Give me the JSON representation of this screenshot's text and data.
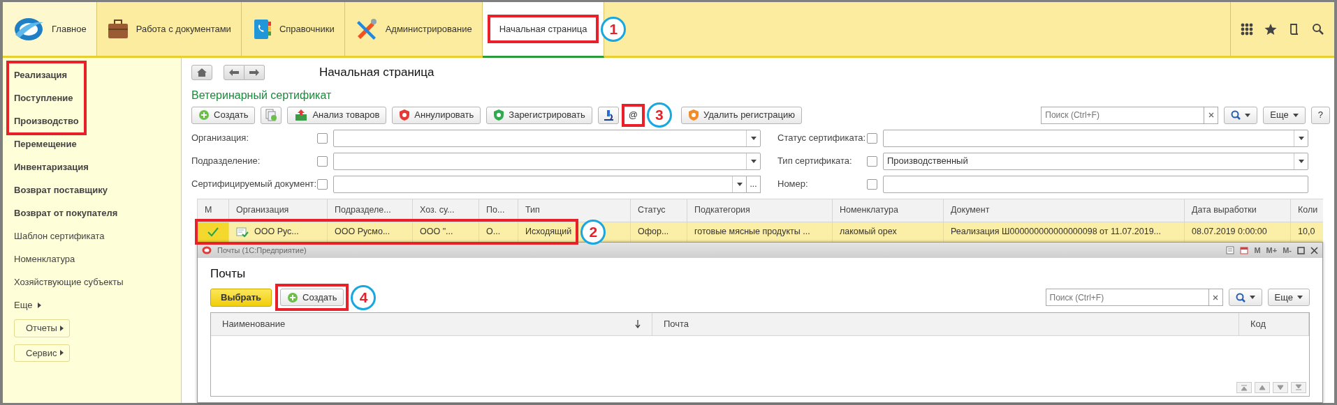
{
  "top_bar": {
    "sections": [
      {
        "label": "Главное",
        "selected": false,
        "highlighted": false
      },
      {
        "label": "Работа с документами",
        "selected": false,
        "highlighted": false
      },
      {
        "label": "Справочники",
        "selected": false,
        "highlighted": false
      },
      {
        "label": "Администрирование",
        "selected": false,
        "highlighted": false
      },
      {
        "label": "Начальная страница",
        "selected": true,
        "highlighted": true,
        "callout": "1"
      }
    ]
  },
  "sidebar": {
    "items": [
      {
        "label": "Реализация",
        "emphasized": true,
        "highlighted": true
      },
      {
        "label": "Поступление",
        "emphasized": true,
        "highlighted": true
      },
      {
        "label": "Производство",
        "emphasized": true,
        "highlighted": true
      },
      {
        "label": "Перемещение",
        "emphasized": true,
        "highlighted": false
      },
      {
        "label": "Инвентаризация",
        "emphasized": true,
        "highlighted": false
      },
      {
        "label": "Возврат поставщику",
        "emphasized": true,
        "highlighted": false
      },
      {
        "label": "Возврат от покупателя",
        "emphasized": true,
        "highlighted": false
      },
      {
        "label": "Шаблон сертификата",
        "emphasized": false,
        "highlighted": false
      },
      {
        "label": "Номенклатура",
        "emphasized": false,
        "highlighted": false
      },
      {
        "label": "Хозяйствующие субъекты",
        "emphasized": false,
        "highlighted": false
      },
      {
        "label": "Еще",
        "emphasized": false,
        "highlighted": false,
        "kind": "more"
      }
    ],
    "buttons": [
      "Отчеты",
      "Сервис"
    ]
  },
  "page": {
    "title": "Начальная страница",
    "form_title": "Ветеринарный сертификат",
    "toolbar": [
      {
        "kind": "button",
        "label": "Создать",
        "highlighted": false
      },
      {
        "kind": "icon",
        "highlighted": false
      },
      {
        "kind": "button",
        "label": "Анализ товаров",
        "highlighted": false
      },
      {
        "kind": "button",
        "label": "Аннулировать",
        "highlighted": false
      },
      {
        "kind": "button",
        "label": "Зарегистрировать",
        "highlighted": false
      },
      {
        "kind": "icon",
        "highlighted": false
      },
      {
        "kind": "text",
        "label": "@",
        "highlighted": true,
        "callout": "3"
      },
      {
        "kind": "button",
        "label": "Удалить регистрацию",
        "highlighted": false
      }
    ],
    "search": {
      "placeholder": "Поиск (Ctrl+F)"
    },
    "more": "Еще",
    "help": "?",
    "filters_left": [
      {
        "label": "Организация:",
        "checked": false,
        "kind": "select"
      },
      {
        "label": "Подразделение:",
        "checked": false,
        "kind": "select"
      },
      {
        "label": "Сертифицируемый документ:",
        "checked": false,
        "kind": "choice",
        "choice_button": "..."
      }
    ],
    "filters_right": [
      {
        "label": "Статус сертификата:",
        "checked": false,
        "kind": "select"
      },
      {
        "label": "Тип сертификата:",
        "checked": false,
        "kind": "select",
        "value": "Производственный"
      },
      {
        "label": "Номер:",
        "checked": false,
        "kind": "text"
      }
    ],
    "table": {
      "columns": [
        "М",
        "Организация",
        "Подразделе...",
        "Хоз. су...",
        "По...",
        "Тип",
        "Статус",
        "Подкатегория",
        "Номенклатура",
        "Документ",
        "Дата выработки",
        "Коли"
      ],
      "rows": [
        {
          "selected": true,
          "highlighted": true,
          "callout": "2",
          "cells": [
            {
              "kind": "mark",
              "checked": true
            },
            {
              "kind": "text",
              "text": "ООО Рус..."
            },
            {
              "kind": "text",
              "text": "ООО Русмо..."
            },
            {
              "kind": "text",
              "text": "ООО \"..."
            },
            {
              "kind": "text",
              "text": "О..."
            },
            {
              "kind": "text",
              "text": "Исходящий"
            },
            {
              "kind": "text",
              "text": "Офор..."
            },
            {
              "kind": "text",
              "text": "готовые мясные продукты ..."
            },
            {
              "kind": "text",
              "text": "лакомый орех"
            },
            {
              "kind": "text",
              "text": "Реализация Ш000000000000000098 от 11.07.2019..."
            },
            {
              "kind": "text",
              "text": "08.07.2019 0:00:00"
            },
            {
              "kind": "text",
              "text": "10,0"
            }
          ]
        }
      ]
    }
  },
  "popup": {
    "window_title": "Почты (1С:Предприятие)",
    "title_buttons": [
      "M",
      "M+",
      "M-"
    ],
    "heading": "Почты",
    "buttons": [
      {
        "kind": "default",
        "label": "Выбрать",
        "highlighted": false
      },
      {
        "kind": "plus",
        "label": "Создать",
        "highlighted": true,
        "callout": "4"
      }
    ],
    "search": {
      "placeholder": "Поиск (Ctrl+F)"
    },
    "more": "Еще",
    "columns": [
      {
        "label": "Наименование",
        "sorted": true
      },
      {
        "label": "Почта",
        "sorted": false
      },
      {
        "label": "Код",
        "sorted": false
      }
    ]
  }
}
